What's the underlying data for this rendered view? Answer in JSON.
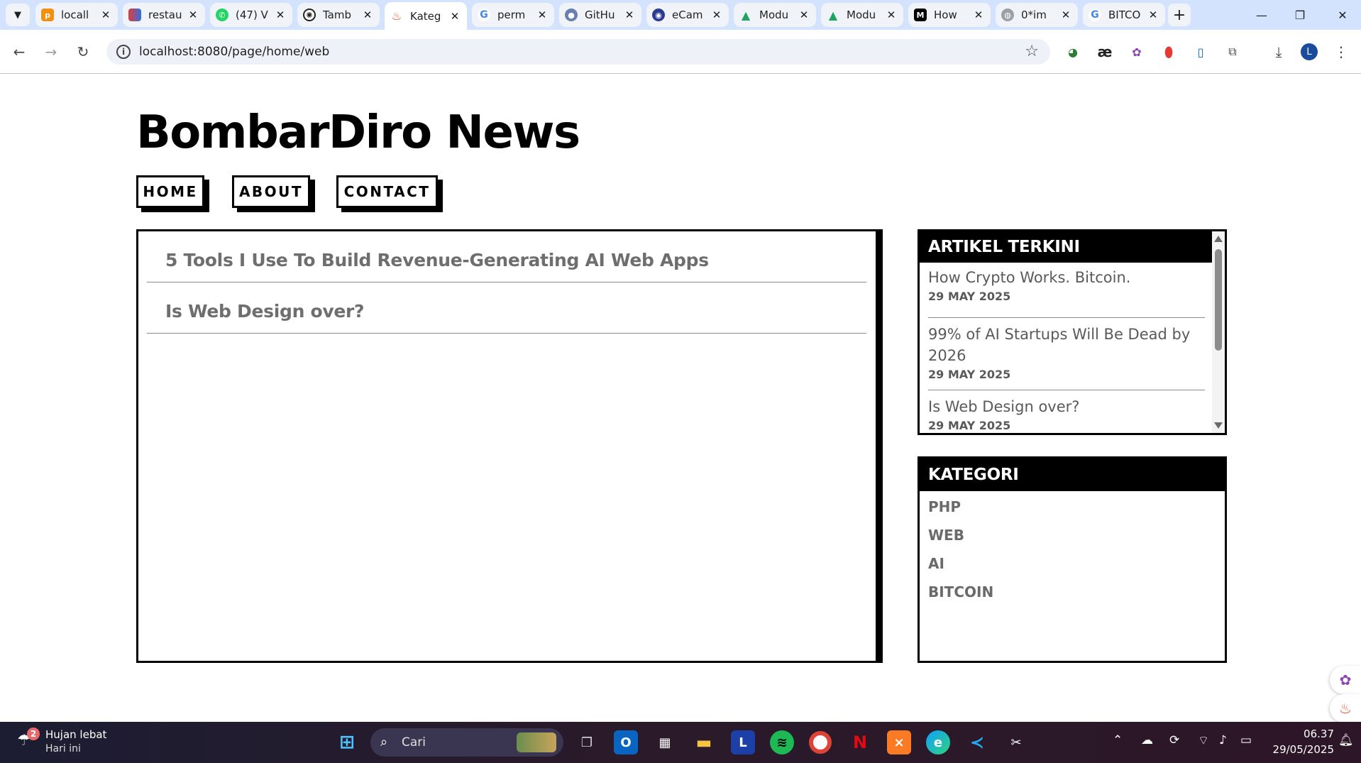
{
  "browser": {
    "tabs": [
      {
        "label": "locall",
        "favicon": "phpmyadmin-icon",
        "color": "#f29111"
      },
      {
        "label": "restau",
        "favicon": "app-icon",
        "color": "#2f6fe0"
      },
      {
        "label": "(47) V",
        "favicon": "whatsapp-icon",
        "color": "#25d366"
      },
      {
        "label": "Tamb",
        "favicon": "openai-icon",
        "color": "#222222"
      },
      {
        "label": "Kateg",
        "favicon": "flame-icon",
        "color": "#e8552a"
      },
      {
        "label": "perm",
        "favicon": "google-icon",
        "color": "#4285f4"
      },
      {
        "label": "GitHu",
        "favicon": "github-icon",
        "color": "#6a7fb0"
      },
      {
        "label": "eCam",
        "favicon": "university-icon",
        "color": "#2a3b8f"
      },
      {
        "label": "Modu",
        "favicon": "google-drive-icon",
        "color": "#1fa463"
      },
      {
        "label": "Modu",
        "favicon": "google-drive-icon",
        "color": "#1fa463"
      },
      {
        "label": "How",
        "favicon": "medium-icon",
        "color": "#000000"
      },
      {
        "label": "0*im",
        "favicon": "globe-icon",
        "color": "#9aa0a6"
      },
      {
        "label": "BITCO",
        "favicon": "google-icon",
        "color": "#4285f4"
      }
    ],
    "active_tab_index": 4,
    "url": "localhost:8080/page/home/web",
    "profile_initial": "L"
  },
  "site": {
    "title": "BombarDiro News",
    "nav": [
      {
        "label": "HOME"
      },
      {
        "label": "ABOUT"
      },
      {
        "label": "CONTACT"
      }
    ]
  },
  "main": {
    "posts": [
      {
        "title": "5 Tools I Use To Build Revenue-Generating AI Web Apps"
      },
      {
        "title": "Is Web Design over?"
      }
    ]
  },
  "sidebar": {
    "recent": {
      "heading": "ARTIKEL TERKINI",
      "items": [
        {
          "title": "How Crypto Works. Bitcoin.",
          "date": "29 MAY 2025"
        },
        {
          "title": "99% of AI Startups Will Be Dead by 2026",
          "date": "29 MAY 2025"
        },
        {
          "title": "Is Web Design over?",
          "date": "29 MAY 2025"
        }
      ]
    },
    "categories": {
      "heading": "KATEGORI",
      "items": [
        {
          "label": "PHP"
        },
        {
          "label": "WEB"
        },
        {
          "label": "AI"
        },
        {
          "label": "BITCOIN"
        }
      ]
    }
  },
  "taskbar": {
    "weather": {
      "title": "Hujan lebat",
      "subtitle": "Hari ini",
      "badge": "2"
    },
    "search_placeholder": "Cari",
    "pinned_icon_names": [
      "windows-start-icon",
      "task-view-icon",
      "outlook-icon",
      "microsoft-store-icon",
      "file-explorer-icon",
      "l-app-icon",
      "spotify-icon",
      "chrome-icon",
      "netflix-icon",
      "xampp-icon",
      "edge-icon",
      "vscode-icon",
      "snipping-tool-icon"
    ],
    "clock": {
      "time": "06.37",
      "date": "29/05/2025"
    }
  }
}
